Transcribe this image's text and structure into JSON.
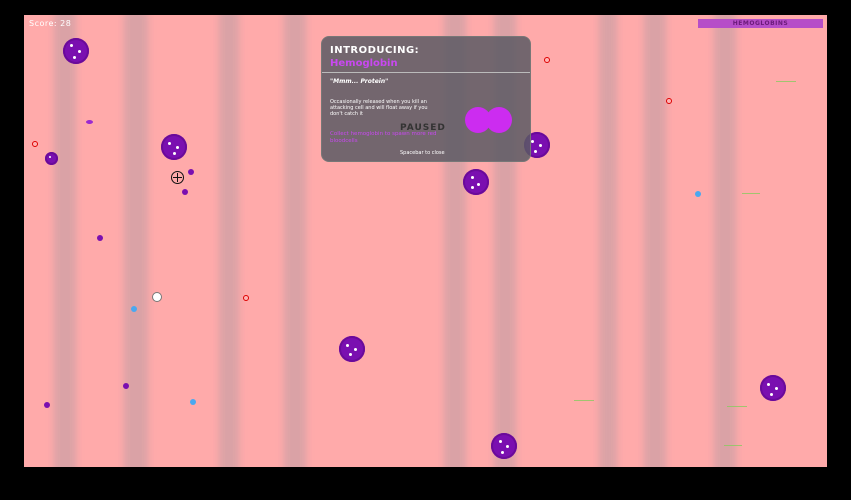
{
  "hud": {
    "score": "Score: 28",
    "hemoglobin_label": "HEMOGLOBINS"
  },
  "panel": {
    "heading": "INTRODUCING:",
    "item": "Hemoglobin",
    "quote": "\"Mmm... Protein\"",
    "desc": "Occasionally released when you kill an attacking cell and will float away if you don't catch it",
    "collect": "Collect hemoglobin to spawn more red bloodcells",
    "paused": "PAUSED",
    "close_hint": "Spacebar to close"
  },
  "colors": {
    "background": "#ffaaaa",
    "virus": "#7a0fb0",
    "hemoglobin": "#cc2cf0",
    "frame": "#000000"
  }
}
